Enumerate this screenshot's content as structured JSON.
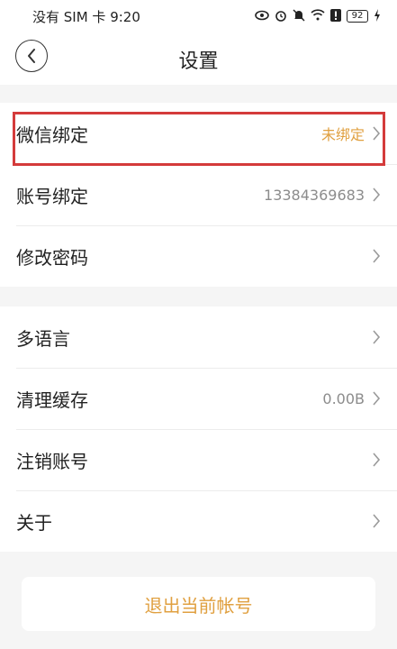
{
  "status_bar": {
    "carrier_time": "没有 SIM 卡 9:20",
    "icons": [
      "eye-icon",
      "alarm-icon",
      "mute-icon",
      "wifi-icon",
      "alert-icon",
      "battery-icon",
      "charging-icon"
    ],
    "battery_level": "92"
  },
  "header": {
    "back_icon": "back-arrow-icon",
    "title": "设置"
  },
  "groups": [
    {
      "rows": [
        {
          "label": "微信绑定",
          "value": "未绑定",
          "value_color": "#e0a040",
          "highlighted": true
        },
        {
          "label": "账号绑定",
          "value": "13384369683"
        },
        {
          "label": "修改密码",
          "value": ""
        }
      ]
    },
    {
      "rows": [
        {
          "label": "多语言",
          "value": ""
        },
        {
          "label": "清理缓存",
          "value": "0.00B"
        },
        {
          "label": "注销账号",
          "value": ""
        },
        {
          "label": "关于",
          "value": ""
        }
      ]
    }
  ],
  "logout": {
    "label": "退出当前帐号"
  },
  "colors": {
    "accent": "#e0a040",
    "highlight_border": "#d43b3b",
    "background": "#f5f5f5"
  }
}
